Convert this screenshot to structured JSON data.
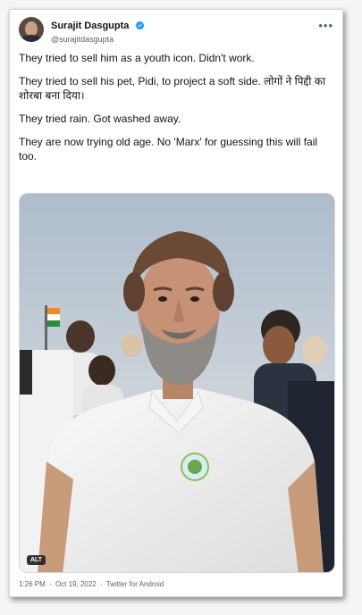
{
  "author": {
    "display_name": "Surajit Dasgupta",
    "handle": "@surajitdasgupta",
    "verified": true
  },
  "menu_icon": "more-horizontal-icon",
  "tweet": {
    "paragraphs": [
      "They tried to sell him as a youth icon. Didn't work.",
      "They tried to sell his pet, Pidi, to project a soft side. लोगों ने पिद्दी का शोरबा बना दिया।",
      "They tried rain. Got washed away.",
      "They are now trying old age. No 'Marx' for guessing this will fail too."
    ]
  },
  "media": {
    "alt_badge": "ALT"
  },
  "meta": {
    "time": "1:26 PM",
    "separator": "·",
    "date": "Oct 19, 2022",
    "source": "Twitter for Android"
  },
  "colors": {
    "text": "#0f1419",
    "muted": "#536471",
    "verified": "#1d9bf0",
    "border": "#cfd9de"
  }
}
